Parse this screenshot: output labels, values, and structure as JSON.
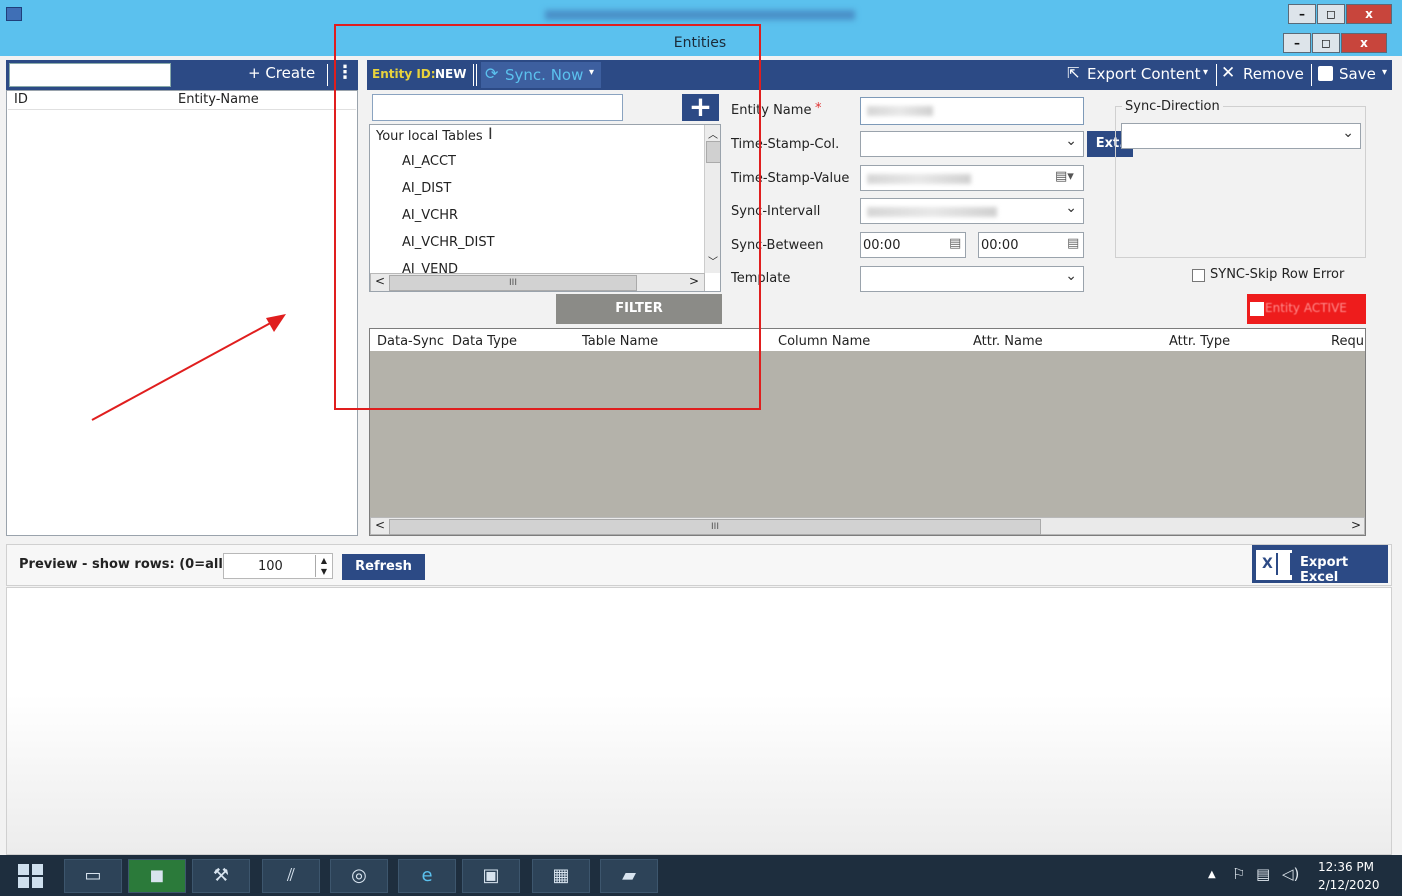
{
  "window": {
    "title": "Entities",
    "minimize": "–",
    "maximize": "◻",
    "close": "x"
  },
  "left_panel": {
    "create_label": "+ Create",
    "menu_icon": "⋮",
    "col_id": "ID",
    "col_entity_name": "Entity-Name"
  },
  "toolbar": {
    "entity_id_label": "Entity ID:",
    "entity_id_value": "NEW",
    "sync_now_label": "Sync. Now",
    "export_content_label": "Export Content",
    "remove_label": "Remove",
    "save_label": "Save"
  },
  "tables": {
    "header": "Your local Tables",
    "items": [
      "AI_ACCT",
      "AI_DIST",
      "AI_VCHR",
      "AI_VCHR_DIST",
      "AI_VEND"
    ],
    "scroll_left": "<",
    "scroll_right": ">",
    "scroll_thumb": "III",
    "filter_label": "FILTER"
  },
  "form": {
    "entity_name_label": "Entity Name",
    "required_mark": "*",
    "timestamp_col_label": "Time-Stamp-Col.",
    "ext_label": "Ext.",
    "timestamp_value_label": "Time-Stamp-Value",
    "sync_interval_label": "Sync-Intervall",
    "sync_between_label": "Sync-Between",
    "sync_between_from": "00:00",
    "sync_between_to": "00:00",
    "template_label": "Template",
    "sync_direction_label": "Sync-Direction",
    "skip_row_error_label": "SYNC-Skip Row Error",
    "entity_active_label": "Entity ACTIVE"
  },
  "grid": {
    "columns": [
      "Data-Sync",
      "Data Type",
      "Table Name",
      "Column Name",
      "Attr. Name",
      "Attr. Type",
      "Requ"
    ],
    "scroll_left": "<",
    "scroll_right": ">",
    "scroll_thumb": "III"
  },
  "preview": {
    "label": "Preview - show rows: (0=all)",
    "rows_value": "100",
    "refresh_label": "Refresh",
    "export_excel_label": "Export Excel",
    "excel_icon_letter": "X"
  },
  "taskbar": {
    "time": "12:36 PM",
    "date": "2/12/2020"
  },
  "colors": {
    "titlebar": "#5bc1ee",
    "navy": "#2c4a85",
    "annotation_red": "#e01e1e",
    "active_red": "#ee1c1c",
    "grid_gray": "#b4b2aa"
  }
}
